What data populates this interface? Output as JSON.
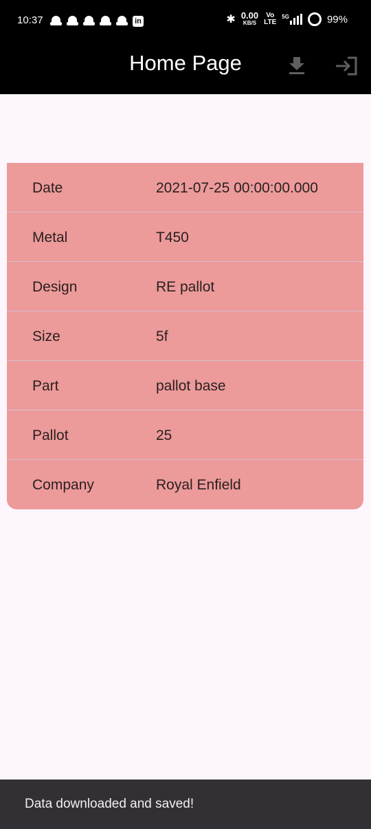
{
  "status_bar": {
    "time": "10:37",
    "speed_value": "0.00",
    "speed_unit": "KB/S",
    "volte_top": "Vo",
    "volte_bottom": "LTE",
    "network": "5G",
    "battery": "99%"
  },
  "app_bar": {
    "title": "Home Page",
    "download_icon": "download-icon",
    "exit_icon": "exit-to-app-icon"
  },
  "details": {
    "rows": [
      {
        "label": "Date",
        "value": "2021-07-25 00:00:00.000"
      },
      {
        "label": "Metal",
        "value": "T450"
      },
      {
        "label": "Design",
        "value": "RE pallot"
      },
      {
        "label": "Size",
        "value": "5f"
      },
      {
        "label": "Part",
        "value": "pallot base"
      },
      {
        "label": "Pallot",
        "value": "25"
      },
      {
        "label": "Company",
        "value": "Royal Enfield"
      }
    ]
  },
  "snackbar": {
    "message": "Data downloaded and saved!"
  },
  "colors": {
    "app_bar": "#000000",
    "card": "#ec9a9a",
    "background": "#fdf6fd",
    "snackbar": "#323034"
  }
}
